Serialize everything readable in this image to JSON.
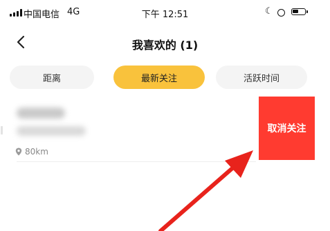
{
  "status_bar": {
    "carrier": "中国电信",
    "network": "4G",
    "time": "下午 12:51"
  },
  "nav": {
    "title": "我喜欢的 (1)"
  },
  "tabs": [
    {
      "label": "距离",
      "active": false
    },
    {
      "label": "最新关注",
      "active": true
    },
    {
      "label": "活跃时间",
      "active": false
    }
  ],
  "list": {
    "items": [
      {
        "distance": "80km",
        "action_label": "取消关注"
      }
    ]
  },
  "colors": {
    "accent_yellow": "#f9c23c",
    "delete_red": "#ff3b30",
    "annotation_arrow": "#e8231c"
  },
  "icons": {
    "back": "chevron-left-icon",
    "location": "location-pin-icon",
    "moon": "moon-icon",
    "battery": "battery-icon"
  }
}
